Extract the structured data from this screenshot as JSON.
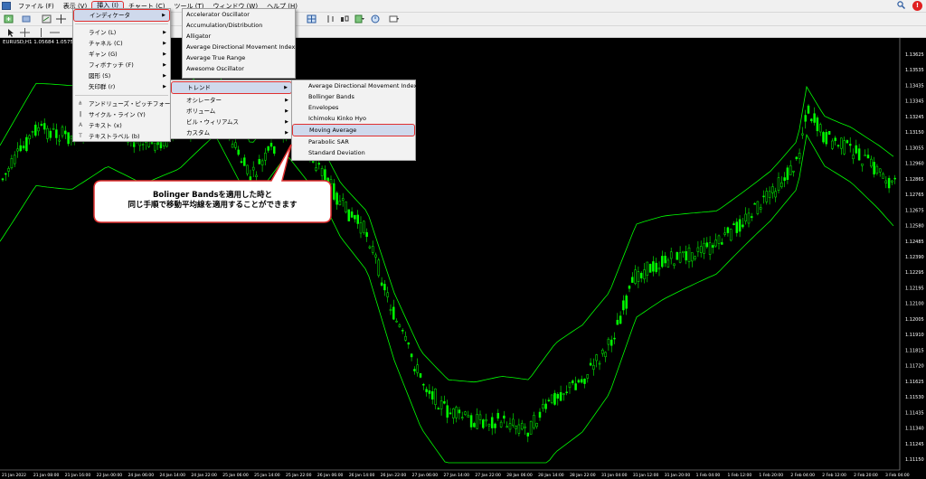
{
  "menubar": {
    "items": [
      {
        "label": "ファイル (F)"
      },
      {
        "label": "表示 (V)"
      },
      {
        "label": "挿入 (I)"
      },
      {
        "label": "チャート (C)"
      },
      {
        "label": "ツール (T)"
      },
      {
        "label": "ウィンドウ (W)"
      },
      {
        "label": "ヘルプ (H)"
      }
    ],
    "active_index": 2,
    "alert_badge": "!"
  },
  "chart": {
    "symbol_label": "EURUSD,H1  1.05684 1.05758 1.0",
    "price_labels": [
      "1.13625",
      "1.13535",
      "1.13435",
      "1.13345",
      "1.13245",
      "1.13150",
      "1.13055",
      "1.12960",
      "1.12865",
      "1.12765",
      "1.12675",
      "1.12580",
      "1.12485",
      "1.12390",
      "1.12295",
      "1.12195",
      "1.12100",
      "1.12005",
      "1.11910",
      "1.11815",
      "1.11720",
      "1.11625",
      "1.11530",
      "1.11435",
      "1.11340",
      "1.11245",
      "1.11150"
    ],
    "time_labels": [
      "21 Jan 2022",
      "21 Jan 08:00",
      "21 Jan 16:00",
      "22 Jan 00:00",
      "24 Jan 06:00",
      "24 Jan 14:00",
      "24 Jan 22:00",
      "25 Jan 06:00",
      "25 Jan 14:00",
      "25 Jan 22:00",
      "26 Jan 06:00",
      "26 Jan 14:00",
      "26 Jan 22:00",
      "27 Jan 06:00",
      "27 Jan 14:00",
      "27 Jan 22:00",
      "28 Jan 06:00",
      "28 Jan 14:00",
      "28 Jan 22:00",
      "31 Jan 04:00",
      "31 Jan 12:00",
      "31 Jan 20:00",
      "1 Feb 04:00",
      "1 Feb 12:00",
      "1 Feb 20:00",
      "2 Feb 04:00",
      "2 Feb 12:00",
      "2 Feb 20:00",
      "3 Feb 04:00"
    ],
    "colors": {
      "candle": "#00ff00",
      "band": "#00ff00",
      "background": "#000000",
      "axis_text": "#ffffff"
    }
  },
  "insert_menu": {
    "indicators_label": "インディケータ",
    "items": [
      {
        "label": "ライン (L)",
        "submenu": true
      },
      {
        "label": "チャネル (C)",
        "submenu": true
      },
      {
        "label": "ギャン (G)",
        "submenu": true
      },
      {
        "label": "フィボナッチ (F)",
        "submenu": true
      },
      {
        "label": "図形 (S)",
        "submenu": true
      },
      {
        "label": "矢印群 (r)",
        "submenu": true
      }
    ],
    "tools": [
      {
        "label": "アンドリューズ・ピッチフォーク (A)",
        "icon": "pitchfork-icon"
      },
      {
        "label": "サイクル・ライン (Y)",
        "icon": "cycle-lines-icon"
      },
      {
        "label": "テキスト (x)",
        "icon": "text-icon"
      },
      {
        "label": "テキストラベル (b)",
        "icon": "text-label-icon"
      }
    ]
  },
  "indicator_menu": {
    "items": [
      "Accelerator Oscillator",
      "Accumulation/Distribution",
      "Alligator",
      "Average Directional Movement Index",
      "Average True Range",
      "Awesome Oscillator"
    ]
  },
  "indicator_sub": {
    "items": [
      {
        "label": "トレンド",
        "highlight": true
      },
      {
        "label": "オシレーター"
      },
      {
        "label": "ボリューム"
      },
      {
        "label": "ビル・ウィリアムス"
      },
      {
        "label": "カスタム"
      }
    ]
  },
  "trend_menu": {
    "items": [
      {
        "label": "Average Directional Movement Index"
      },
      {
        "label": "Bollinger Bands"
      },
      {
        "label": "Envelopes"
      },
      {
        "label": "Ichimoku Kinko Hyo"
      },
      {
        "label": "Moving Average",
        "highlight": true
      },
      {
        "label": "Parabolic SAR"
      },
      {
        "label": "Standard Deviation"
      }
    ]
  },
  "callout": {
    "line1": "Bolinger Bandsを適用した時と",
    "line2": "同じ手順で移動平均線を適用することができます"
  }
}
